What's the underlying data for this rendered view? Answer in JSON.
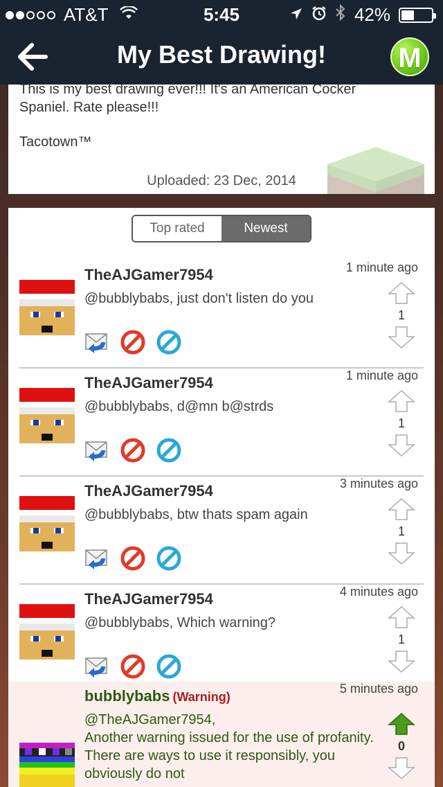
{
  "status_bar": {
    "carrier": "AT&T",
    "time": "5:45",
    "battery": "42%",
    "battery_level": 0.42
  },
  "nav": {
    "title": "My Best Drawing!",
    "m_button_label": "M"
  },
  "description": {
    "text": "This is my best drawing ever!!! It's an American Cocker Spaniel. Rate please!!!",
    "signature": "Tacotown™",
    "uploaded": "Uploaded: 23 Dec, 2014"
  },
  "sort_tabs": {
    "top_rated": "Top rated",
    "newest": "Newest",
    "selected": "Newest"
  },
  "comments": [
    {
      "username": "TheAJGamer7954",
      "time": "1 minute ago",
      "text": "@bubblybabs, just don't listen do you",
      "votes": "1"
    },
    {
      "username": "TheAJGamer7954",
      "time": "1 minute ago",
      "text": "@bubblybabs, d@mn b@strds",
      "votes": "1"
    },
    {
      "username": "TheAJGamer7954",
      "time": "3 minutes ago",
      "text": "@bubblybabs, btw thats spam again",
      "votes": "1"
    },
    {
      "username": "TheAJGamer7954",
      "time": "4 minutes ago",
      "text": "@bubblybabs, Which warning?",
      "votes": "1"
    },
    {
      "username": "bubblybabs",
      "tag": "(Warning)",
      "time": "5 minutes ago",
      "text": "@TheAJGamer7954,\nAnother warning issued for the use of profanity. There are ways to use it responsibly, you obviously do not",
      "votes": "0"
    }
  ],
  "colors": {
    "nav_bg": "#1a2330",
    "warning_bg": "#fdeeee",
    "moderator_name": "#2a5a10",
    "warning_tag": "#b01c1c",
    "upvote_active": "#4c9a1e"
  }
}
